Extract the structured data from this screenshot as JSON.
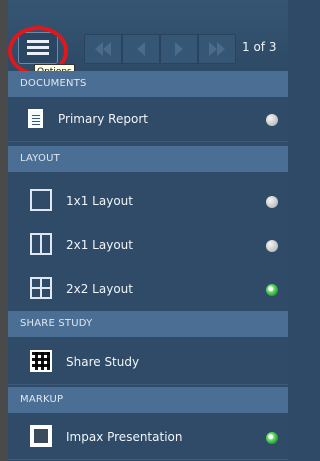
{
  "header": {
    "tooltip": "Options",
    "pager": "1 of 3"
  },
  "sections": {
    "documents": "DOCUMENTS",
    "layout": "LAYOUT",
    "share": "SHARE STUDY",
    "markup": "MARKUP"
  },
  "documents": [
    {
      "label": "Primary Report",
      "selected": false
    }
  ],
  "layouts": [
    {
      "label": "1x1 Layout",
      "selected": false
    },
    {
      "label": "2x1 Layout",
      "selected": false
    },
    {
      "label": "2x2 Layout",
      "selected": true
    }
  ],
  "share": [
    {
      "label": "Share Study"
    }
  ],
  "markup": [
    {
      "label": "Impax Presentation",
      "selected": true
    }
  ]
}
